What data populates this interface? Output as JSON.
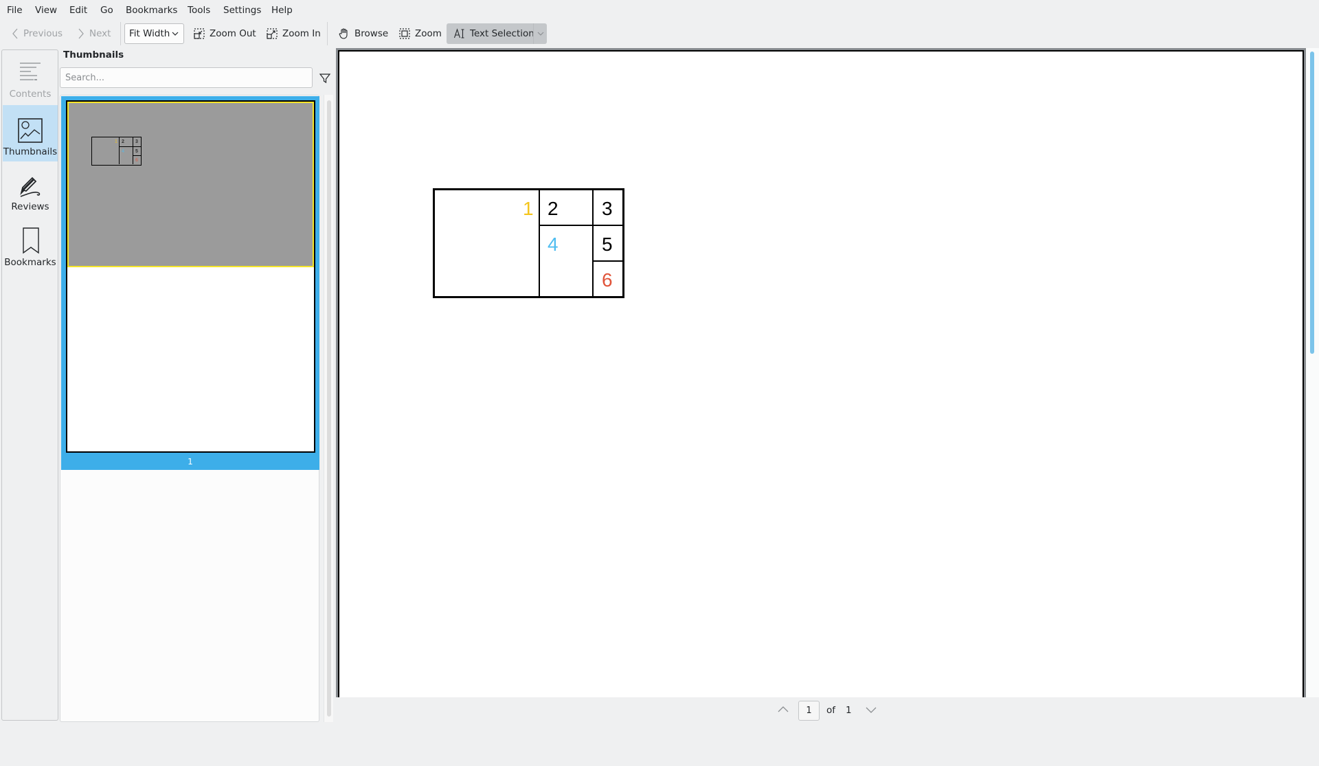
{
  "menu": [
    "File",
    "View",
    "Edit",
    "Go",
    "Bookmarks",
    "Tools",
    "Settings",
    "Help"
  ],
  "toolbar": {
    "previous": "Previous",
    "next": "Next",
    "zoom_mode": "Fit Width",
    "zoom_out": "Zoom Out",
    "zoom_in": "Zoom In",
    "browse": "Browse",
    "zoom": "Zoom",
    "text_selection": "Text Selection"
  },
  "sidebar": {
    "items": [
      {
        "label": "Contents",
        "icon": "contents-icon",
        "state": "disabled"
      },
      {
        "label": "Thumbnails",
        "icon": "image-icon",
        "state": "active"
      },
      {
        "label": "Reviews",
        "icon": "pen-icon",
        "state": "normal"
      },
      {
        "label": "Bookmarks",
        "icon": "bookmark-icon",
        "state": "normal"
      }
    ]
  },
  "thumbnails_panel": {
    "title": "Thumbnails",
    "search_placeholder": "Search...",
    "search_value": "",
    "pages": [
      {
        "number": "1",
        "selected": true
      }
    ]
  },
  "document": {
    "table_cells": [
      {
        "label": "1",
        "color": "#f4c51b"
      },
      {
        "label": "2",
        "color": "#000000"
      },
      {
        "label": "3",
        "color": "#000000"
      },
      {
        "label": "4",
        "color": "#4fbdf0"
      },
      {
        "label": "5",
        "color": "#000000"
      },
      {
        "label": "6",
        "color": "#e0543a"
      }
    ]
  },
  "navigation": {
    "current_page": "1",
    "of_label": "of",
    "total_pages": "1"
  },
  "colors": {
    "accent": "#3daee9",
    "scrollbar": "#7cc4ea",
    "sidebar_active": "#c2e0f5"
  }
}
